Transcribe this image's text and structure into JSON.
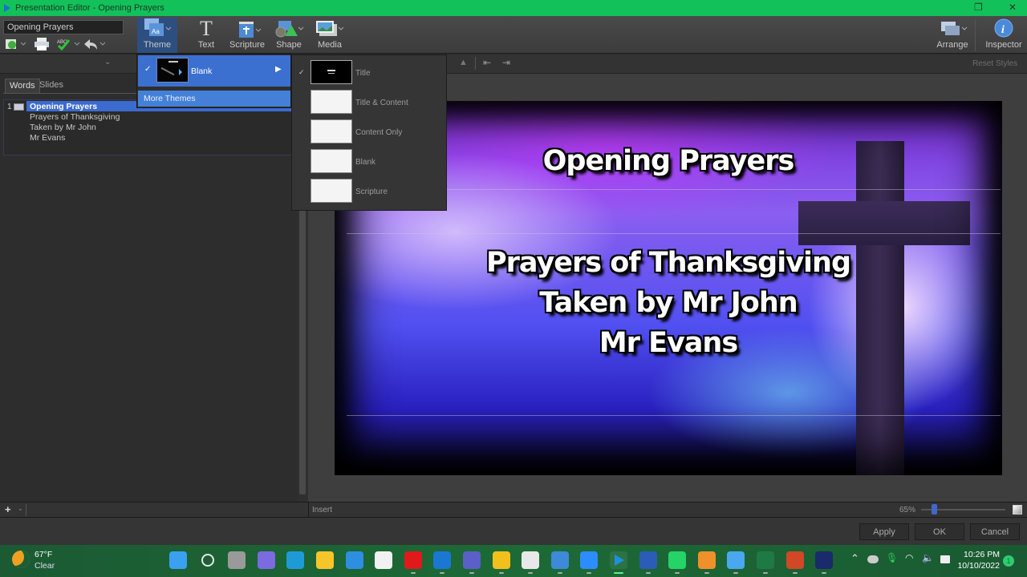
{
  "window": {
    "title": "Presentation Editor - Opening Prayers",
    "controls": [
      "minimize",
      "restore",
      "close"
    ]
  },
  "toolbar": {
    "document_name": "Opening Prayers",
    "quick_actions": [
      {
        "name": "new-slide-icon",
        "has_dropdown": true
      },
      {
        "name": "print-icon",
        "has_dropdown": false
      },
      {
        "name": "spellcheck-icon",
        "has_dropdown": true
      },
      {
        "name": "undo-icon",
        "has_dropdown": true
      }
    ],
    "buttons": [
      {
        "id": "theme",
        "label": "Theme",
        "icon": "theme-icon",
        "active": true
      },
      {
        "id": "text",
        "label": "Text",
        "icon": "text-icon",
        "active": false
      },
      {
        "id": "scripture",
        "label": "Scripture",
        "icon": "bible-icon",
        "active": false
      },
      {
        "id": "shape",
        "label": "Shape",
        "icon": "shape-icon",
        "active": false
      },
      {
        "id": "media",
        "label": "Media",
        "icon": "media-icon",
        "active": false
      }
    ],
    "right_buttons": [
      {
        "id": "arrange",
        "label": "Arrange",
        "icon": "arrange-icon"
      },
      {
        "id": "inspector",
        "label": "Inspector",
        "icon": "info-icon"
      }
    ]
  },
  "left_panel": {
    "tabs": [
      {
        "label": "Words",
        "active": true
      },
      {
        "label": "Slides",
        "active": false
      }
    ],
    "slides": [
      {
        "number": "1",
        "lines": [
          "Opening Prayers",
          "Prayers of Thanksgiving",
          "Taken by Mr John",
          "Mr Evans"
        ]
      }
    ],
    "footer": {
      "add_label": "+"
    }
  },
  "theme_menu": {
    "current_theme": "Blank",
    "more_themes_label": "More Themes",
    "layouts": [
      {
        "label": "Title",
        "checked": true,
        "dark": true
      },
      {
        "label": "Title & Content",
        "checked": false,
        "dark": false
      },
      {
        "label": "Content Only",
        "checked": false,
        "dark": false
      },
      {
        "label": "Blank",
        "checked": false,
        "dark": false
      },
      {
        "label": "Scripture",
        "checked": false,
        "dark": false
      }
    ]
  },
  "editor": {
    "reset_styles_label": "Reset Styles",
    "insert_label": "Insert",
    "zoom_label": "65%",
    "zoom_value": 65,
    "slide": {
      "title": "Opening Prayers",
      "body": [
        "Prayers of Thanksgiving",
        "Taken by Mr John",
        "Mr Evans"
      ]
    }
  },
  "dialog_buttons": {
    "apply": "Apply",
    "ok": "OK",
    "cancel": "Cancel"
  },
  "taskbar": {
    "weather": {
      "temp": "67°F",
      "condition": "Clear"
    },
    "apps": [
      {
        "name": "start",
        "color": "#3aa0f0"
      },
      {
        "name": "search",
        "color": "#e8e8e8"
      },
      {
        "name": "task-view",
        "color": "#9a9a9a"
      },
      {
        "name": "teams-chat",
        "color": "#7b6ae0"
      },
      {
        "name": "edge",
        "color": "#1e9bd7"
      },
      {
        "name": "file-explorer",
        "color": "#f5c52a"
      },
      {
        "name": "mail",
        "color": "#2c8fe0"
      },
      {
        "name": "store",
        "color": "#f1f1f1"
      },
      {
        "name": "opera",
        "color": "#e01a1a"
      },
      {
        "name": "outlook",
        "color": "#1a78d2"
      },
      {
        "name": "teams",
        "color": "#5b5fc7"
      },
      {
        "name": "chrome",
        "color": "#f2c01c"
      },
      {
        "name": "snipping-tool",
        "color": "#e8e8e8"
      },
      {
        "name": "photos",
        "color": "#3c8ad8"
      },
      {
        "name": "zoom",
        "color": "#2d8cff"
      },
      {
        "name": "presentation-app",
        "color": "#1f8fe0"
      },
      {
        "name": "word",
        "color": "#2b5cb8"
      },
      {
        "name": "whatsapp",
        "color": "#25d366"
      },
      {
        "name": "notes-app",
        "color": "#f0902a"
      },
      {
        "name": "notepad",
        "color": "#4aa8f0"
      },
      {
        "name": "excel",
        "color": "#1e7a44"
      },
      {
        "name": "powerpoint",
        "color": "#d24726"
      },
      {
        "name": "webex",
        "color": "#1a2a6a"
      }
    ],
    "time": "10:26 PM",
    "date": "10/10/2022",
    "notification_count": "1"
  }
}
